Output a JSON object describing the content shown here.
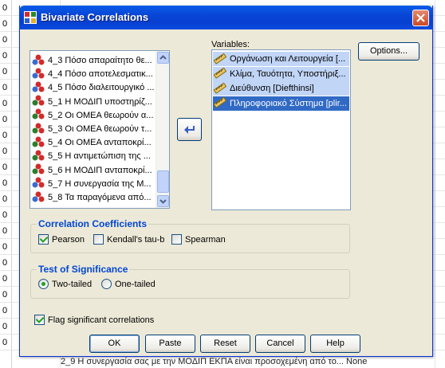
{
  "window": {
    "title": "Bivariate Correlations"
  },
  "background": {
    "row_digits": [
      "0",
      "0",
      "0",
      "0",
      "0",
      "0",
      "0",
      "0",
      "0",
      "0",
      "0",
      "0",
      "0",
      "0",
      "0",
      "0",
      "0",
      "0",
      "0",
      "0",
      "0",
      "0"
    ],
    "bottom_text": "2_9  Η συνεργασία σας με την ΜΟΔΙΠ ΕΚΠΑ είναι προσοχεμένη από το...  None"
  },
  "source_list": {
    "items": [
      {
        "label": "4_3 Πόσο απαραίτητο θε...",
        "icon": "ordinal-variable-icon"
      },
      {
        "label": "4_4 Πόσο αποτελεσματικ...",
        "icon": "ordinal-variable-icon"
      },
      {
        "label": "4_5 Πόσο διαλειτουργικό ...",
        "icon": "ordinal-variable-icon"
      },
      {
        "label": "5_1 Η ΜΟΔΙΠ υποστηρίζ...",
        "icon": "nominal-variable-icon"
      },
      {
        "label": "5_2 Οι ΟΜΕΑ θεωρούν α...",
        "icon": "nominal-variable-icon"
      },
      {
        "label": "5_3 Οι ΟΜΕΑ θεωρούν τ...",
        "icon": "nominal-variable-icon"
      },
      {
        "label": "5_4 Οι ΟΜΕΑ ανταποκρί...",
        "icon": "nominal-variable-icon"
      },
      {
        "label": "5_5 Η αντιμετώπιση της ...",
        "icon": "nominal-variable-icon"
      },
      {
        "label": "5_6 Η ΜΟΔΙΠ ανταποκρί...",
        "icon": "nominal-variable-icon"
      },
      {
        "label": "5_7 Η συνεργασία της Μ...",
        "icon": "ordinal-variable-icon"
      },
      {
        "label": "5_8 Τα παραγόμενα από...",
        "icon": "ordinal-variable-icon"
      }
    ]
  },
  "variables": {
    "label": "Variables:",
    "items": [
      {
        "label": "Οργάνωση και Λειτουργεία [...",
        "state": "highlighted"
      },
      {
        "label": "Κλίμα, Ταυότητα, Υποστήριξ...",
        "state": "highlighted"
      },
      {
        "label": "Διεύθυνση [Diefthinsi]",
        "state": "highlighted"
      },
      {
        "label": "Πληροφοριακό Σύστημα [plir...",
        "state": "selected"
      }
    ]
  },
  "buttons": {
    "options": "Options...",
    "ok": "OK",
    "paste": "Paste",
    "reset": "Reset",
    "cancel": "Cancel",
    "help": "Help"
  },
  "correlation": {
    "title": "Correlation Coefficients",
    "pearson": {
      "label": "Pearson",
      "checked": true
    },
    "kendall": {
      "label": "Kendall's tau-b",
      "checked": false
    },
    "spearman": {
      "label": "Spearman",
      "checked": false
    }
  },
  "significance": {
    "title": "Test of Significance",
    "two_tailed": {
      "label": "Two-tailed",
      "selected": true
    },
    "one_tailed": {
      "label": "One-tailed",
      "selected": false
    }
  },
  "flag": {
    "label": "Flag significant correlations",
    "checked": true
  },
  "colors": {
    "title_bar": "#0845d6",
    "dialog_bg": "#ece9d8",
    "group_title": "#0046d5",
    "selection": "#316ac5"
  }
}
